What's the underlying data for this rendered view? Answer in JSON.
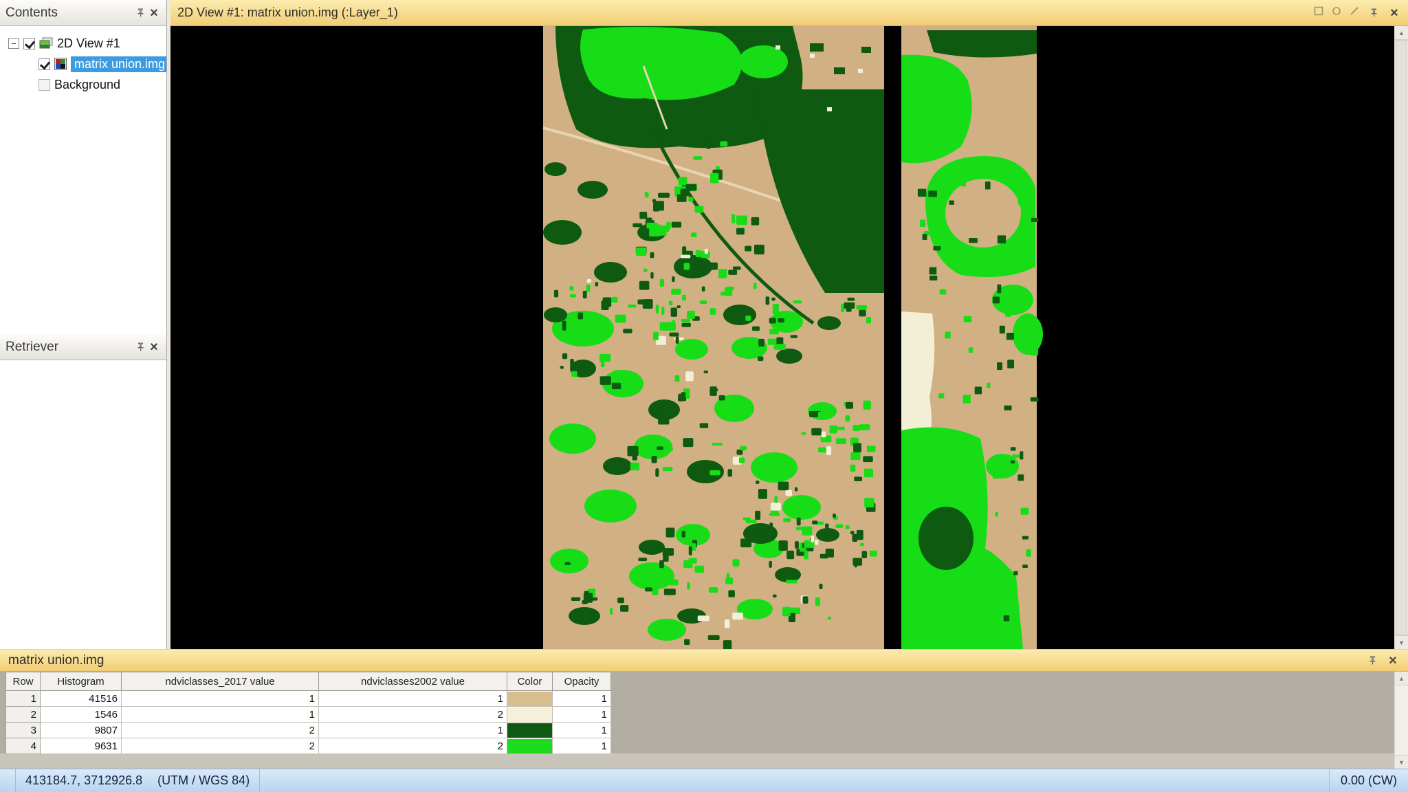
{
  "contents_panel": {
    "title": "Contents",
    "tree": {
      "view_item": "2D View #1",
      "layer_item": "matrix union.img",
      "background_item": "Background"
    }
  },
  "retriever_panel": {
    "title": "Retriever"
  },
  "view": {
    "title": "2D View #1: matrix union.img (:Layer_1)"
  },
  "attribute_panel": {
    "title": "matrix union.img",
    "columns": [
      "Row",
      "Histogram",
      "ndviclasses_2017 value",
      "ndviclasses2002 value",
      "Color",
      "Opacity"
    ],
    "rows": [
      {
        "row": "1",
        "histogram": "41516",
        "ndvi2017": "1",
        "ndvi2002": "1",
        "color": "#d8bd8e",
        "opacity": "1"
      },
      {
        "row": "2",
        "histogram": "1546",
        "ndvi2017": "1",
        "ndvi2002": "2",
        "color": "#f5f1d9",
        "opacity": "1"
      },
      {
        "row": "3",
        "histogram": "9807",
        "ndvi2017": "2",
        "ndvi2002": "1",
        "color": "#0f5a13",
        "opacity": "1"
      },
      {
        "row": "4",
        "histogram": "9631",
        "ndvi2017": "2",
        "ndvi2002": "2",
        "color": "#1bdd1b",
        "opacity": "1"
      }
    ]
  },
  "status_bar": {
    "coordinates": "413184.7, 3712926.8",
    "projection": "(UTM / WGS 84)",
    "rotation": "0.00 (CW)"
  },
  "map": {
    "colors": {
      "background": "#000000",
      "tan": "#d1b183",
      "cream": "#f3eed6",
      "dark_green": "#0d5a10",
      "bright_green": "#17dd17"
    }
  }
}
